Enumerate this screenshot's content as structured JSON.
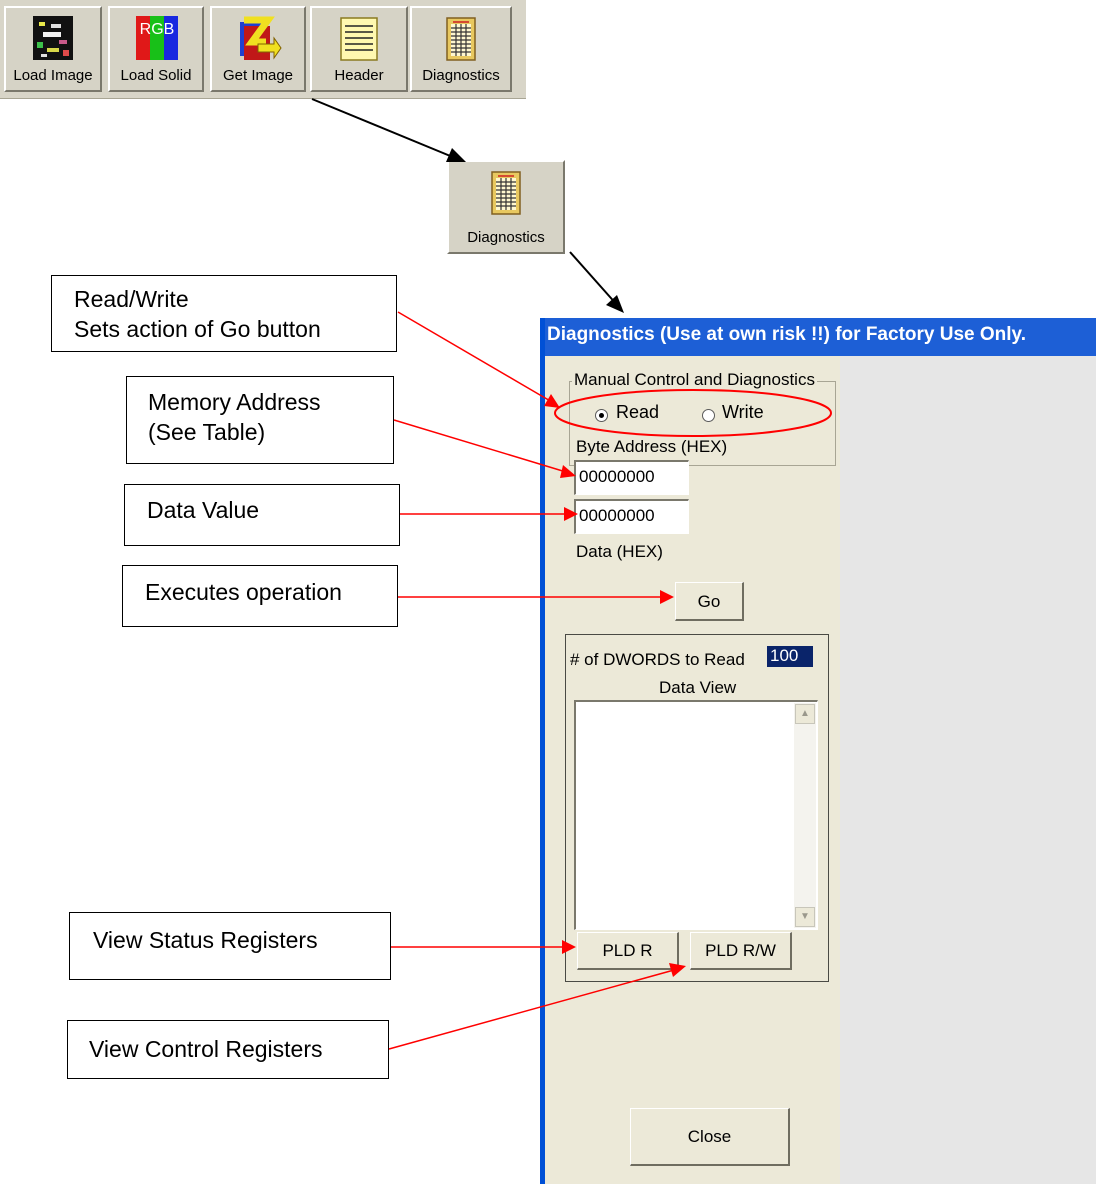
{
  "toolbar": {
    "buttons": [
      {
        "label": "Load Image",
        "icon": "load-image-icon"
      },
      {
        "label": "Load Solid",
        "icon": "rgb-icon",
        "icon_text": "RGB"
      },
      {
        "label": "Get Image",
        "icon": "get-image-icon"
      },
      {
        "label": "Header",
        "icon": "header-icon"
      },
      {
        "label": "Diagnostics",
        "icon": "diagnostics-icon"
      }
    ]
  },
  "zoomed_button": {
    "label": "Diagnostics",
    "icon": "diagnostics-icon"
  },
  "callouts": {
    "read_write": {
      "line1": "Read/Write",
      "line2": "Sets action of Go button"
    },
    "memory_address": {
      "line1": "Memory Address",
      "line2": "(See Table)"
    },
    "data_value": {
      "text": "Data Value"
    },
    "executes": {
      "text": "Executes operation"
    },
    "status_registers": {
      "text": "View Status Registers"
    },
    "control_registers": {
      "text": "View Control Registers"
    }
  },
  "dialog": {
    "title": "Diagnostics (Use at own risk !!) for Factory Use Only.",
    "manual_group": "Manual Control and Diagnostics",
    "radio_read": "Read",
    "radio_write": "Write",
    "selected_mode": "Read",
    "byte_address_label": "Byte Address (HEX)",
    "byte_address_value": "00000000",
    "data_value": "00000000",
    "data_label": "Data (HEX)",
    "go_label": "Go",
    "dwords_label": "# of DWORDS to Read",
    "dwords_value": "100",
    "data_view_label": "Data View",
    "pld_r_label": "PLD R",
    "pld_rw_label": "PLD R/W",
    "close_label": "Close"
  },
  "colors": {
    "title_bar": "#1d5fd6",
    "dialog_bg": "#ece9d8",
    "highlight": "#0a246a",
    "annotation_arrow": "#ff0000",
    "flow_arrow": "#000000"
  }
}
